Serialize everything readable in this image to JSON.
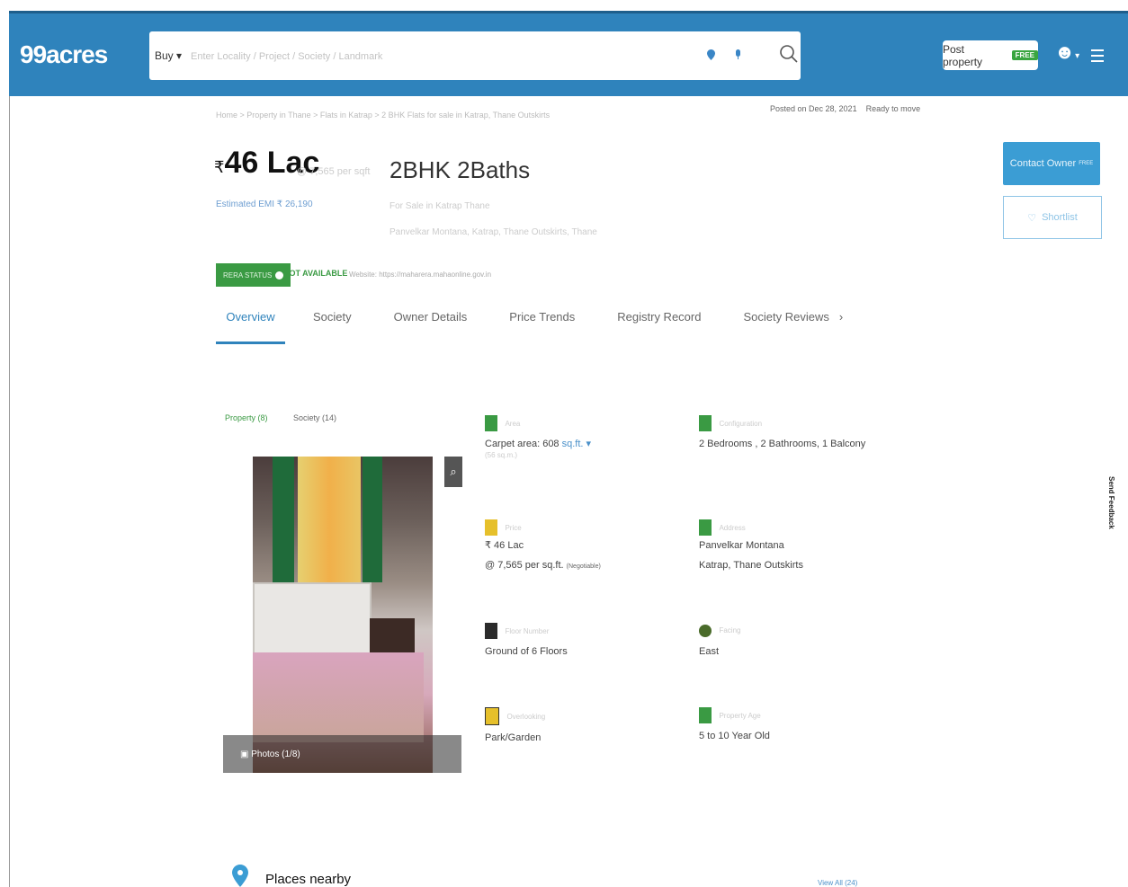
{
  "header": {
    "logo": "99acres",
    "search": {
      "buy_label": "Buy",
      "placeholder": "Enter Locality / Project / Society / Landmark"
    },
    "post_property_label": "Post property",
    "free_badge": "FREE"
  },
  "listing": {
    "breadcrumb": "Home > Property in Thane > Flats in Katrap > 2 BHK Flats for sale in Katrap, Thane Outskirts",
    "posted": "Posted on Dec 28, 2021",
    "status": "Ready to move",
    "price": "46 Lac",
    "currency": "₹",
    "price_per_sqft": "@ 7,565 per sqft",
    "emi": "Estimated EMI ₹ 26,190",
    "config": "2BHK 2Baths",
    "sub_line_1": "For Sale in Katrap Thane",
    "sub_line_2": "Panvelkar Montana, Katrap, Thane Outskirts, Thane",
    "contact_owner": "Contact Owner",
    "contact_badge": "FREE",
    "shortlist": "Shortlist"
  },
  "rera": {
    "label": "RERA STATUS",
    "status": "NOT AVAILABLE",
    "website": "Website: https://maharera.mahaonline.gov.in"
  },
  "tabs": [
    "Overview",
    "Society",
    "Owner Details",
    "Price Trends",
    "Registry Record",
    "Society Reviews"
  ],
  "photo_tabs": {
    "property": "Property (8)",
    "society": "Society (14)",
    "photos": "Photos (1/8)"
  },
  "features": {
    "area": {
      "label": "Area",
      "value": "Carpet area: 608",
      "unit": "sq.ft.",
      "extra": "(56 sq.m.)"
    },
    "configuration": {
      "label": "Configuration",
      "value": "2 Bedrooms , 2 Bathrooms, 1 Balcony"
    },
    "price": {
      "label": "Price",
      "value": "₹ 46 Lac",
      "sub": "@ 7,565 per sq.ft.",
      "negotiable": "(Negotiable)"
    },
    "address": {
      "label": "Address",
      "line1": "Panvelkar Montana",
      "line2": "Katrap, Thane Outskirts"
    },
    "floor": {
      "label": "Floor Number",
      "value": "Ground of 6 Floors"
    },
    "facing": {
      "label": "Facing",
      "value": "East"
    },
    "overlooking": {
      "label": "Overlooking",
      "value": "Park/Garden"
    },
    "age": {
      "label": "Property Age",
      "value": "5 to 10 Year Old"
    }
  },
  "places": {
    "title": "Places nearby",
    "view_all": "View All (24)"
  },
  "feedback": "Send Feedback",
  "colors": {
    "brand_blue": "#2f83bc",
    "green": "#3a9a43"
  }
}
